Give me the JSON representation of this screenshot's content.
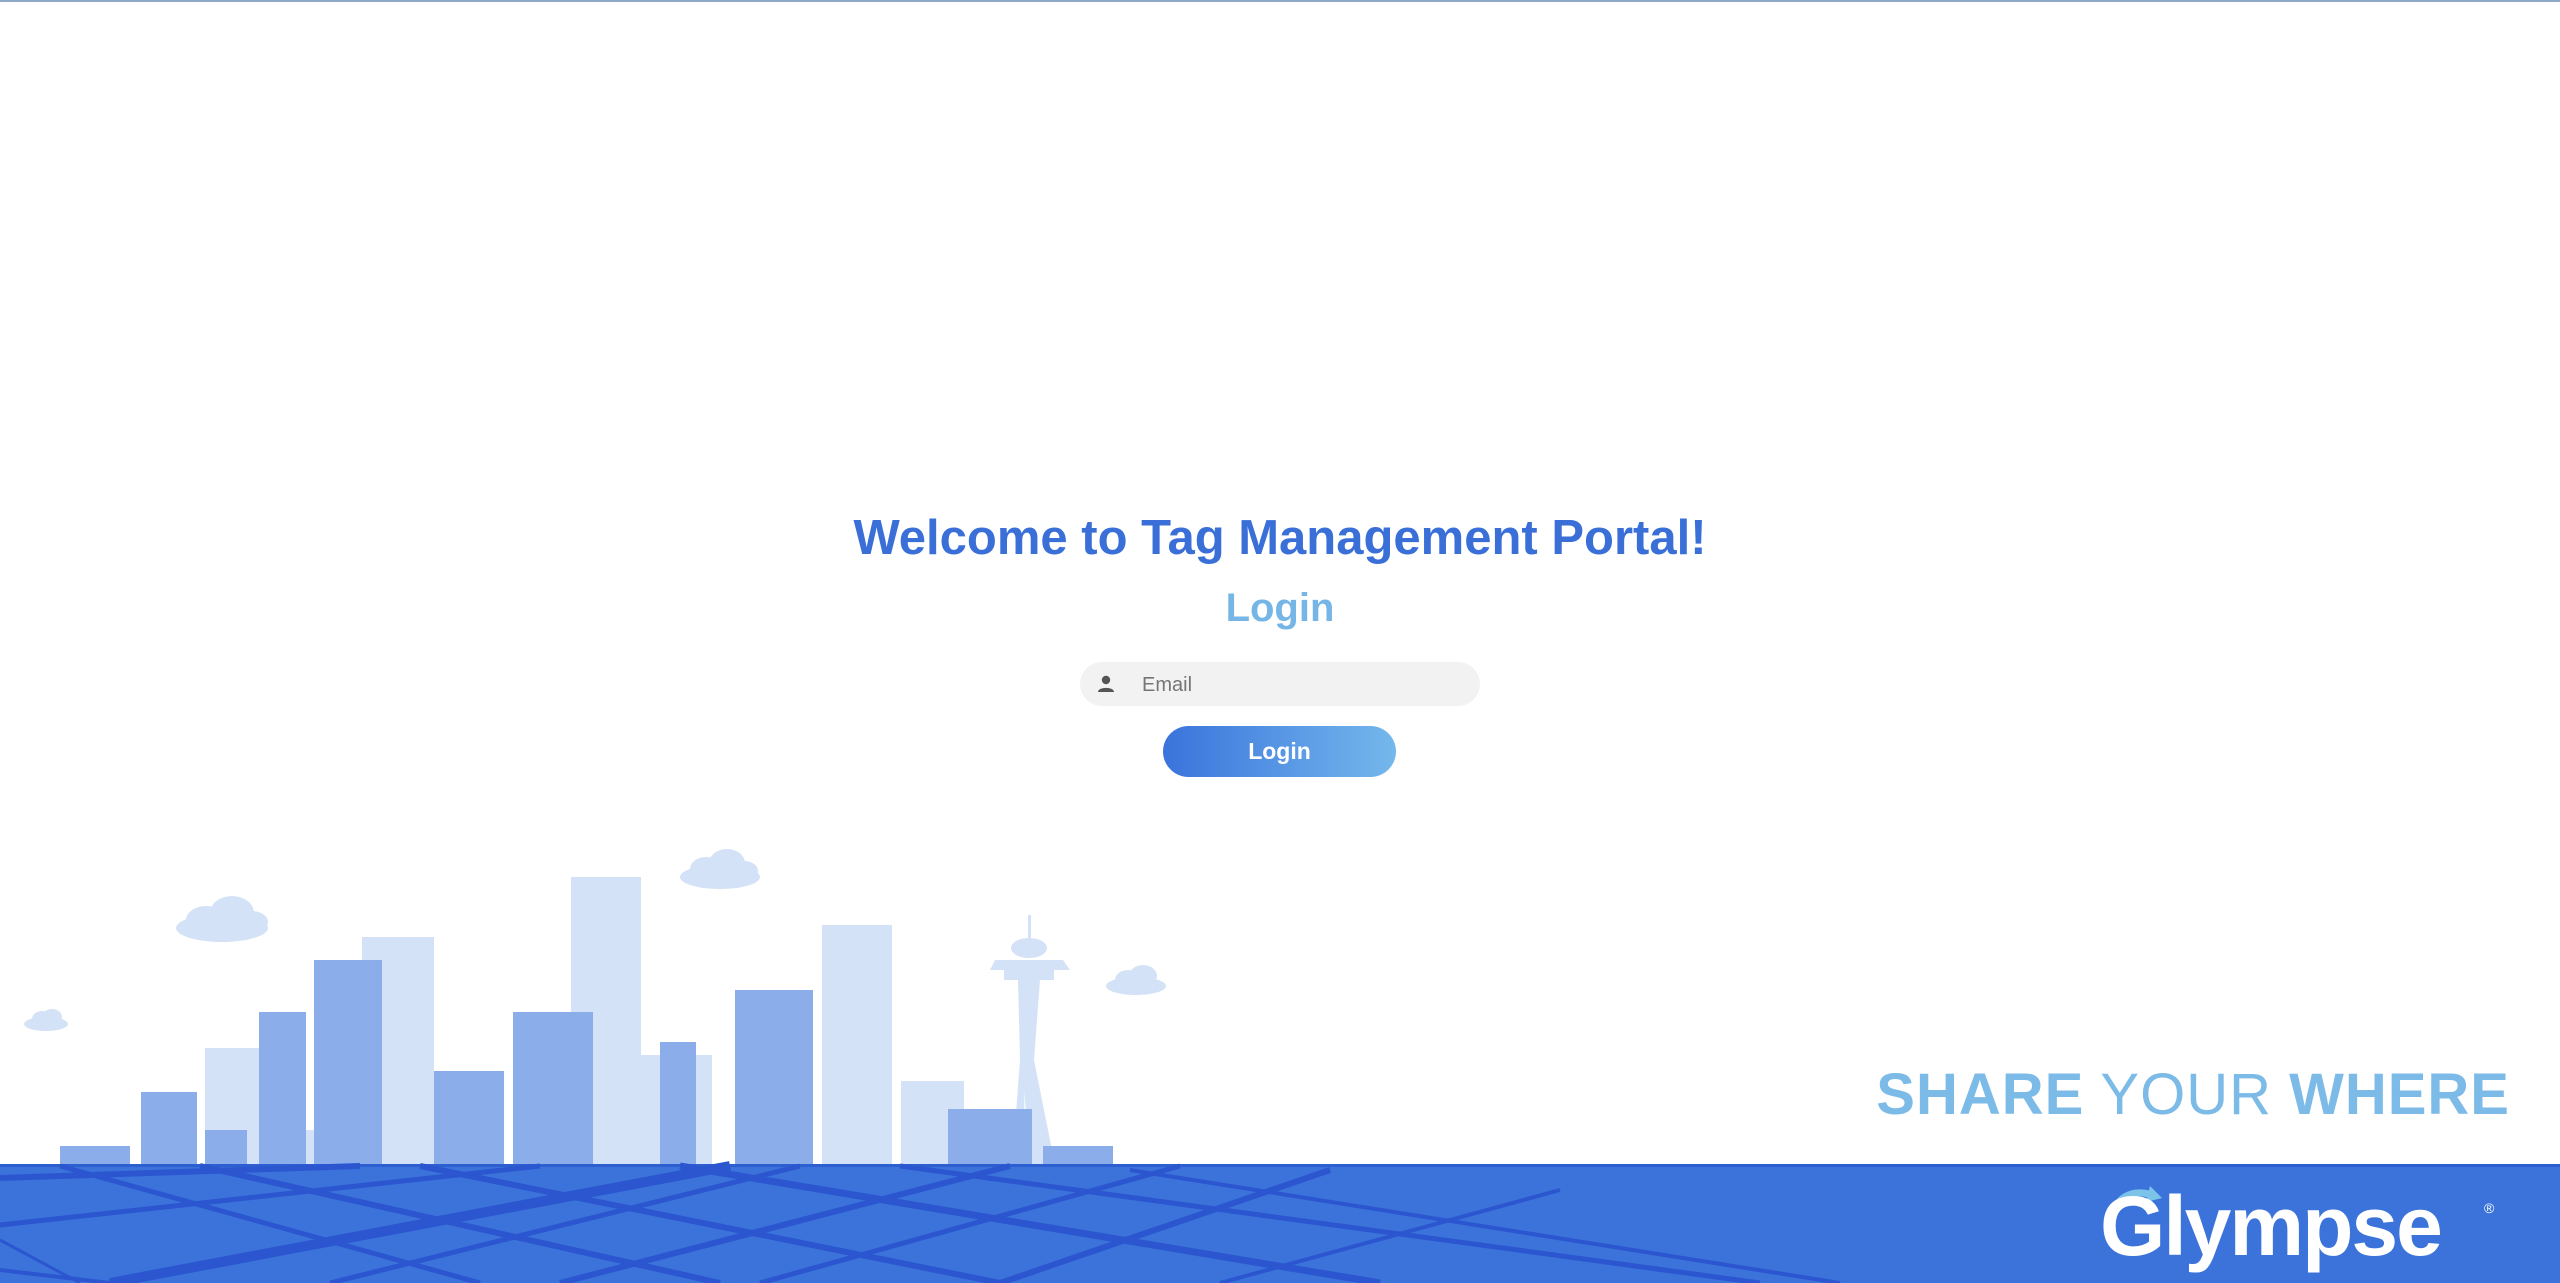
{
  "header": {
    "title": "Welcome to Tag Management Portal!",
    "subtitle": "Login"
  },
  "login_form": {
    "email_placeholder": "Email",
    "email_value": "",
    "submit_label": "Login",
    "user_icon": "person-icon"
  },
  "branding": {
    "tagline_part1": "SHARE",
    "tagline_part2": "YOUR",
    "tagline_part3": "WHERE",
    "logo_text": "Glympse",
    "logo_mark": "®",
    "logo_arrow_icon": "refresh-arrow-icon"
  },
  "colors": {
    "title_blue": "#3a6fd8",
    "login_light_blue": "#76b6e6",
    "ground_blue": "#3b73db",
    "road_blue": "#2b56cf",
    "building_dark": "#8badea",
    "building_light": "#d4e2f7",
    "button_gradient_start": "#3a73dc",
    "button_gradient_end": "#74b8ec"
  }
}
